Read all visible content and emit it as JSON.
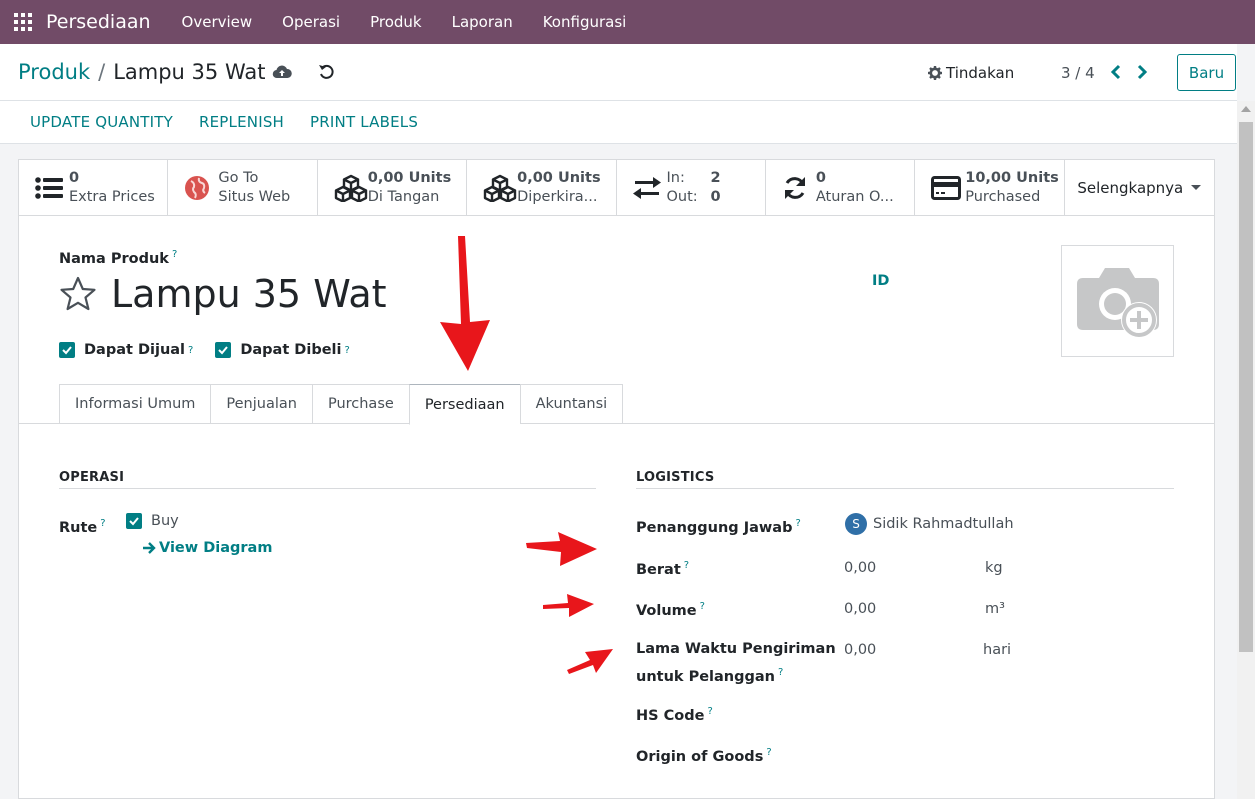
{
  "navbar": {
    "brand": "Persediaan",
    "items": [
      "Overview",
      "Operasi",
      "Produk",
      "Laporan",
      "Konfigurasi"
    ]
  },
  "control": {
    "breadcrumb_parent": "Produk",
    "breadcrumb_sep": "/",
    "breadcrumb_current": "Lampu 35 Wat",
    "actions_label": "Tindakan",
    "pager": "3 / 4",
    "new_label": "Baru"
  },
  "statusbar": {
    "buttons": [
      "UPDATE QUANTITY",
      "REPLENISH",
      "PRINT LABELS"
    ]
  },
  "smart_buttons": [
    {
      "value": "0",
      "label": "Extra Prices",
      "icon": "list-icon"
    },
    {
      "value": "Go To",
      "label": "Situs Web",
      "icon": "globe-icon"
    },
    {
      "value": "0,00 Units",
      "label": "Di Tangan",
      "icon": "cubes-icon"
    },
    {
      "value": "0,00 Units",
      "label": "Diperkira...",
      "icon": "cubes-icon"
    },
    {
      "in_label": "In:",
      "in_value": "2",
      "out_label": "Out:",
      "out_value": "0",
      "icon": "exchange-icon"
    },
    {
      "value": "0",
      "label": "Aturan O...",
      "icon": "refresh-icon"
    },
    {
      "value": "10,00 Units",
      "label": "Purchased",
      "icon": "credit-card-icon"
    }
  ],
  "more_label": "Selengkapnya",
  "product": {
    "name_label": "Nama Produk",
    "help_mark": "?",
    "name": "Lampu 35 Wat",
    "id_label": "ID",
    "can_be_sold_label": "Dapat Dijual",
    "can_be_purchased_label": "Dapat Dibeli"
  },
  "tabs": [
    "Informasi Umum",
    "Penjualan",
    "Purchase",
    "Persediaan",
    "Akuntansi"
  ],
  "active_tab": "Persediaan",
  "operations": {
    "title": "OPERASI",
    "route_label": "Rute",
    "route_value": "Buy",
    "view_diagram": "View Diagram"
  },
  "logistics": {
    "title": "LOGISTICS",
    "responsible_label": "Penanggung Jawab",
    "responsible_initial": "S",
    "responsible_name": "Sidik Rahmadtullah",
    "weight_label": "Berat",
    "weight_value": "0,00",
    "weight_unit": "kg",
    "volume_label": "Volume",
    "volume_value": "0,00",
    "volume_unit": "m³",
    "lead_label_1": "Lama Waktu Pengiriman",
    "lead_label_2": "untuk Pelanggan",
    "lead_value": "0,00",
    "lead_unit": "hari",
    "hs_label": "HS Code",
    "origin_label": "Origin of Goods"
  },
  "colors": {
    "navbar": "#714b67",
    "accent": "#017e84",
    "annotation": "#e8161b"
  }
}
